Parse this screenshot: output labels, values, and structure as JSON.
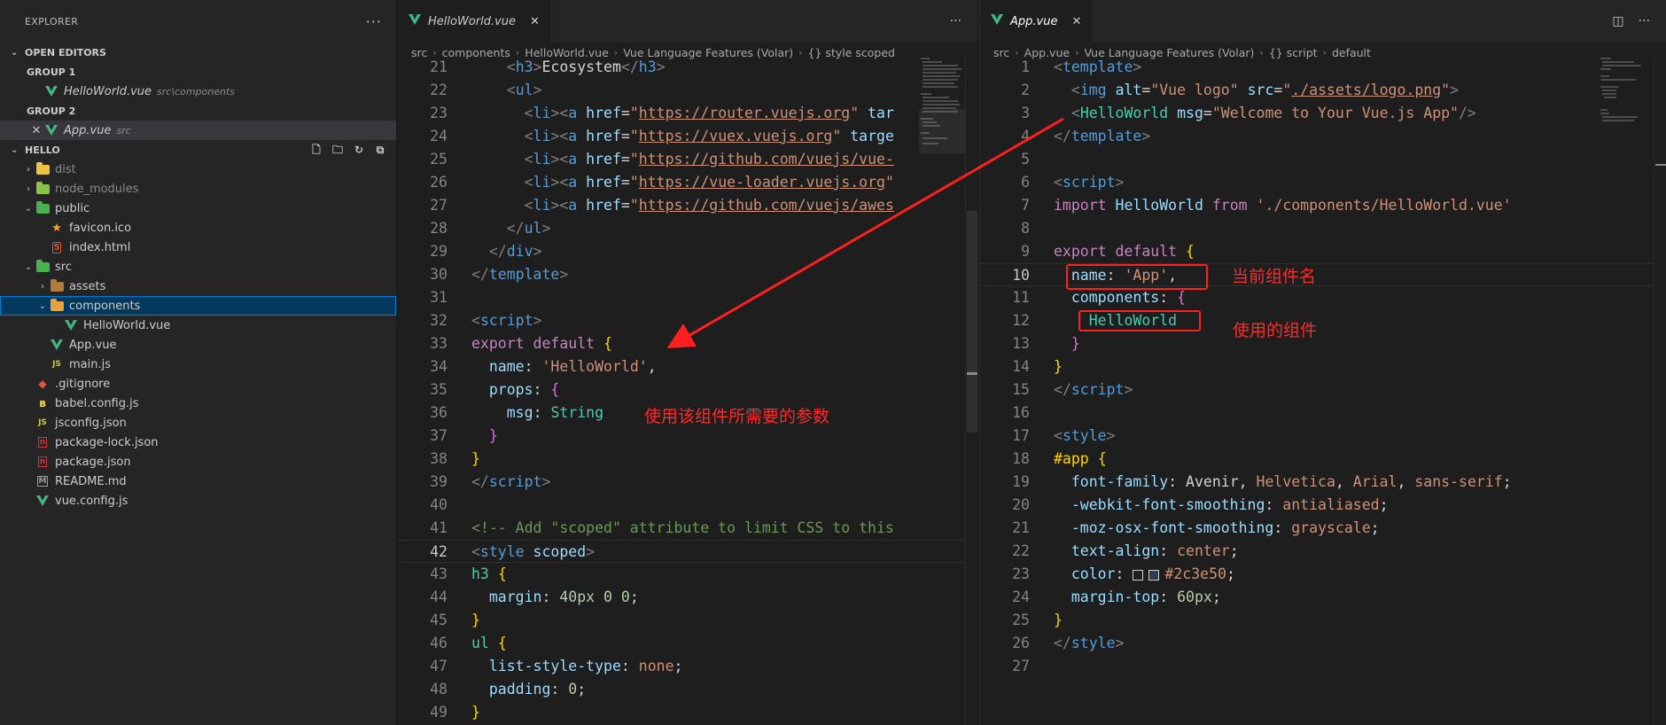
{
  "explorer": {
    "title": "EXPLORER",
    "more": "···",
    "open_editors": "OPEN EDITORS",
    "group1": "GROUP 1",
    "group1_file": "HelloWorld.vue",
    "group1_path": "src\\components",
    "group2": "GROUP 2",
    "group2_file": "App.vue",
    "group2_path": "src",
    "project": "HELLO",
    "tree": [
      {
        "label": "dist",
        "icon": "folder-icon",
        "indent": 1,
        "twisty": "›"
      },
      {
        "label": "node_modules",
        "icon": "folder-icon",
        "indent": 1,
        "twisty": "›"
      },
      {
        "label": "public",
        "icon": "folder-icon",
        "indent": 1,
        "twisty": "⌄"
      },
      {
        "label": "favicon.ico",
        "icon": "favicon-icon",
        "indent": 2,
        "twisty": ""
      },
      {
        "label": "index.html",
        "icon": "html-icon",
        "indent": 2,
        "twisty": ""
      },
      {
        "label": "src",
        "icon": "folder-icon",
        "indent": 1,
        "twisty": "⌄"
      },
      {
        "label": "assets",
        "icon": "folder-icon",
        "indent": 2,
        "twisty": "›"
      },
      {
        "label": "components",
        "icon": "folder-icon",
        "indent": 2,
        "twisty": "⌄"
      },
      {
        "label": "HelloWorld.vue",
        "icon": "vue-icon",
        "indent": 3,
        "twisty": ""
      },
      {
        "label": "App.vue",
        "icon": "vue-icon",
        "indent": 2,
        "twisty": ""
      },
      {
        "label": "main.js",
        "icon": "js-icon",
        "indent": 2,
        "twisty": ""
      },
      {
        "label": ".gitignore",
        "icon": "git-icon",
        "indent": 1,
        "twisty": ""
      },
      {
        "label": "babel.config.js",
        "icon": "babel-icon",
        "indent": 1,
        "twisty": ""
      },
      {
        "label": "jsconfig.json",
        "icon": "js-icon",
        "indent": 1,
        "twisty": ""
      },
      {
        "label": "package-lock.json",
        "icon": "npm-icon",
        "indent": 1,
        "twisty": ""
      },
      {
        "label": "package.json",
        "icon": "npm-icon",
        "indent": 1,
        "twisty": ""
      },
      {
        "label": "README.md",
        "icon": "markdown-icon",
        "indent": 1,
        "twisty": ""
      },
      {
        "label": "vue.config.js",
        "icon": "vue-icon",
        "indent": 1,
        "twisty": ""
      }
    ]
  },
  "left_editor": {
    "tab": "HelloWorld.vue",
    "breadcrumbs": [
      "src",
      "components",
      "HelloWorld.vue",
      "Vue Language Features (Volar)",
      "{} style scoped"
    ],
    "line_numbers": [
      "21",
      "22",
      "23",
      "24",
      "25",
      "26",
      "27",
      "28",
      "29",
      "30",
      "31",
      "32",
      "33",
      "34",
      "35",
      "36",
      "37",
      "38",
      "39",
      "40",
      "41",
      "42",
      "43",
      "44",
      "45",
      "46",
      "47",
      "48",
      "49"
    ],
    "current_line": "42",
    "annotation": "使用该组件所需要的参数"
  },
  "right_editor": {
    "tab": "App.vue",
    "breadcrumbs": [
      "src",
      "App.vue",
      "Vue Language Features (Volar)",
      "{} script",
      "default"
    ],
    "line_numbers": [
      "1",
      "2",
      "3",
      "4",
      "5",
      "6",
      "7",
      "8",
      "9",
      "10",
      "11",
      "12",
      "13",
      "14",
      "15",
      "16",
      "17",
      "18",
      "19",
      "20",
      "21",
      "22",
      "23",
      "24",
      "25",
      "26",
      "27"
    ],
    "current_line": "10",
    "annotation_name": "当前组件名",
    "annotation_components": "使用的组件"
  },
  "colors": {
    "annotation_red": "#ff2a2a",
    "vue_green": "#41b883",
    "swatch": "#2c3e50"
  }
}
